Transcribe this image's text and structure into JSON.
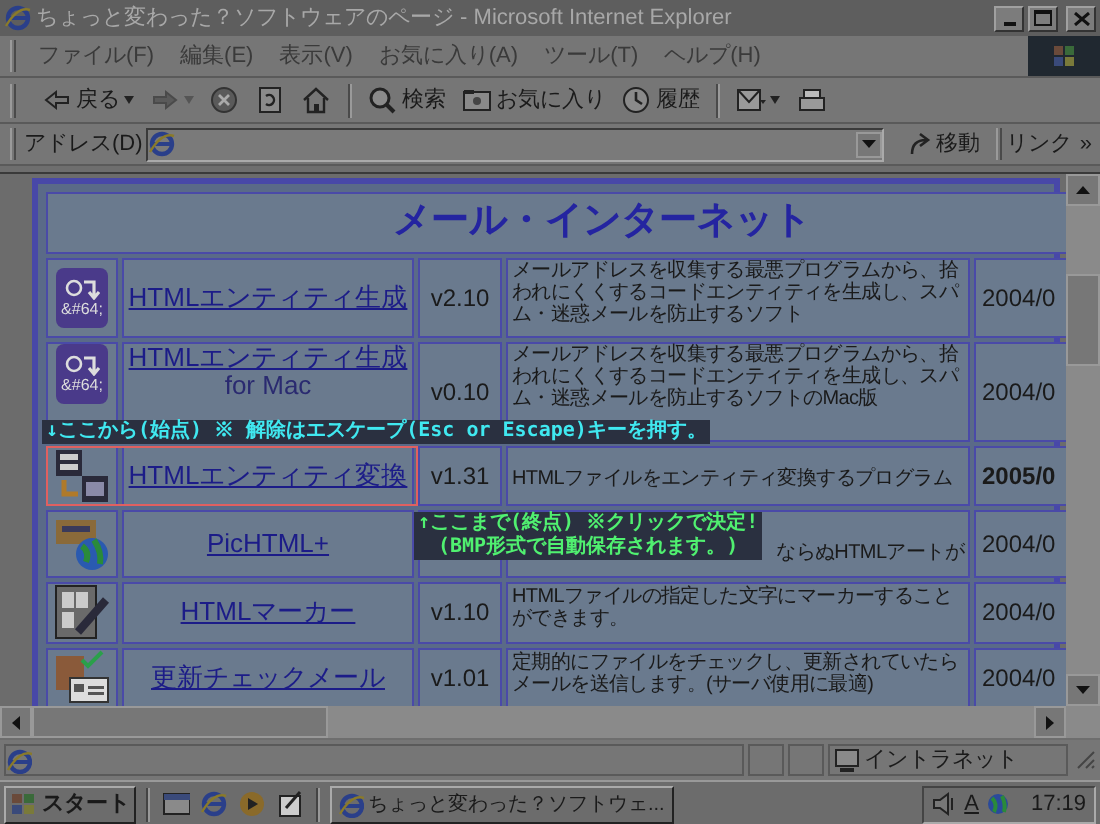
{
  "window": {
    "title": "ちょっと変わった？ソフトウェアのページ - Microsoft Internet Explorer"
  },
  "menu": [
    "ファイル(F)",
    "編集(E)",
    "表示(V)",
    "お気に入り(A)",
    "ツール(T)",
    "ヘルプ(H)"
  ],
  "toolbar": [
    {
      "kind": "back",
      "label": "戻る"
    },
    {
      "kind": "forward"
    },
    {
      "kind": "stop"
    },
    {
      "kind": "refresh"
    },
    {
      "kind": "home"
    },
    {
      "kind": "search",
      "label": "検索"
    },
    {
      "kind": "favorites",
      "label": "お気に入り"
    },
    {
      "kind": "history",
      "label": "履歴"
    },
    {
      "kind": "mail"
    },
    {
      "kind": "print"
    }
  ],
  "address_bar": {
    "label": "アドレス(D)",
    "go": "移動",
    "links": "リンク",
    "more": "»"
  },
  "table": {
    "heading": "メール・インターネット",
    "rows": [
      {
        "kind": "entity",
        "icon_text": "&#64;",
        "name": "HTMLエンティティ生成",
        "version": "v2.10",
        "description": "メールアドレスを収集する最悪プログラムから、拾われにくくするコードエンティティを生成し、スパム・迷惑メールを防止するソフト",
        "date": "2004/0"
      },
      {
        "kind": "entity",
        "icon_text": "&#64;",
        "name": "HTMLエンティティ生成",
        "name_line2": "for Mac",
        "version": "v0.10",
        "description": "メールアドレスを収集する最悪プログラムから、拾われにくくするコードエンティティを生成し、スパム・迷惑メールを防止するソフトのMac版",
        "date": "2004/0"
      },
      {
        "kind": "convert",
        "name": "HTMLエンティティ変換",
        "version": "v1.31",
        "description": "HTMLファイルをエンティティ変換するプログラム",
        "date": "2005/0",
        "date_bold": true,
        "selected": true
      },
      {
        "kind": "picture",
        "name": "PicHTML+",
        "description": "ならぬHTMLアートが",
        "date": "2004/0"
      },
      {
        "kind": "marker",
        "name": "HTMLマーカー",
        "version": "v1.10",
        "description": "HTMLファイルの指定した文字にマーカーすることができます。",
        "date": "2004/0"
      },
      {
        "kind": "check",
        "name": "更新チェックメール",
        "version": "v1.01",
        "description": "定期的にファイルをチェックし、更新されていたらメールを送信します。(サーバ使用に最適)",
        "date": "2004/0"
      }
    ]
  },
  "capture_overlay": {
    "start_hint": "↓ここから(始点) ※ 解除はエスケープ(Esc or Escape)キーを押す。",
    "end_hint": [
      "↑ここまで(終点) ※クリックで決定!",
      "(BMP形式で自動保存されます。)"
    ]
  },
  "status_bar": {
    "zone": "イントラネット"
  },
  "taskbar": {
    "start": "スタート",
    "task": "ちょっと変わった？ソフトウェ...",
    "tray_text": "A",
    "clock": "17:19"
  }
}
